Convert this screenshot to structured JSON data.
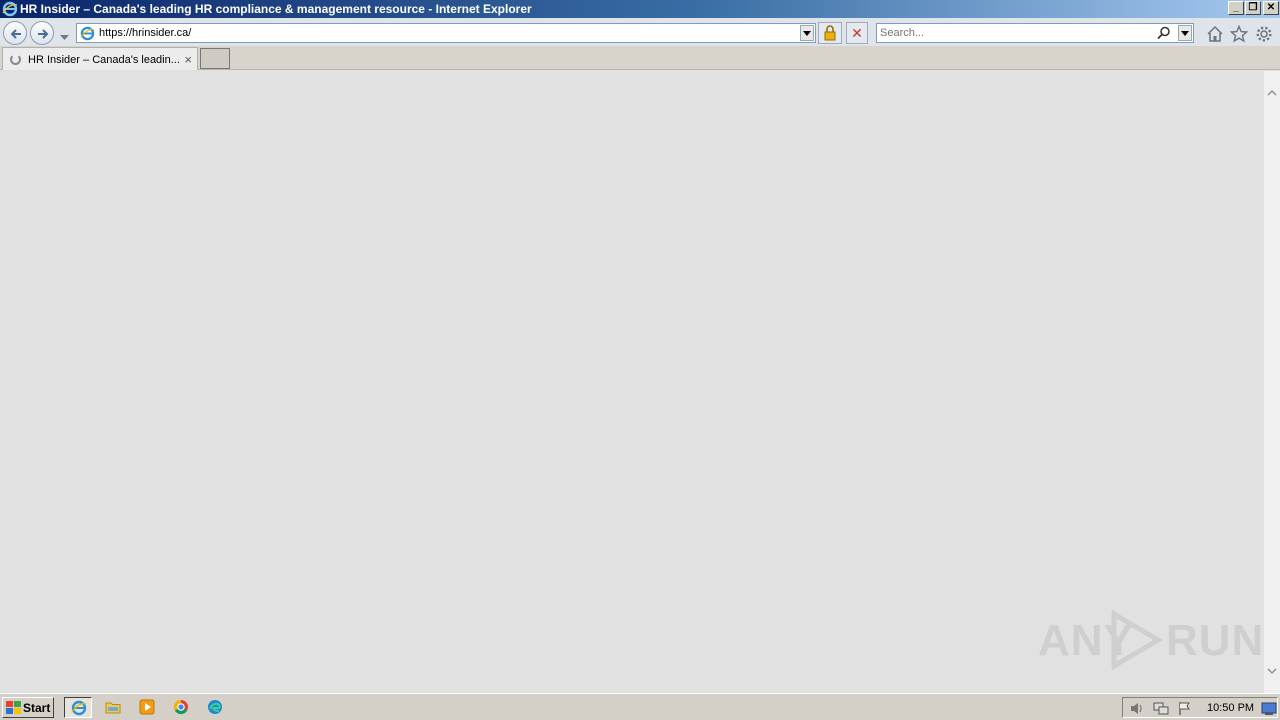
{
  "window": {
    "title": "HR Insider – Canada's leading HR compliance & management resource - Internet Explorer",
    "minimize_label": "_",
    "restore_label": "❐",
    "close_label": "✕"
  },
  "address_bar": {
    "url": "https://hrinsider.ca/"
  },
  "search": {
    "placeholder": "Search..."
  },
  "tabs": [
    {
      "label": "HR Insider – Canada's leadin...",
      "loading": true,
      "close_label": "×"
    }
  ],
  "stop_label": "✕",
  "watermark": {
    "left_text": "ANY",
    "right_text": "RUN"
  },
  "taskbar": {
    "start_label": "Start",
    "apps": [
      "internet-explorer",
      "file-explorer",
      "media-player",
      "chrome",
      "edge"
    ],
    "clock": "10:50 PM"
  },
  "colors": {
    "title_gradient_start": "#0a246a",
    "title_gradient_end": "#a6caf0",
    "content_bg": "#e1e1e1",
    "taskbar_bg": "#d4d0c8"
  }
}
